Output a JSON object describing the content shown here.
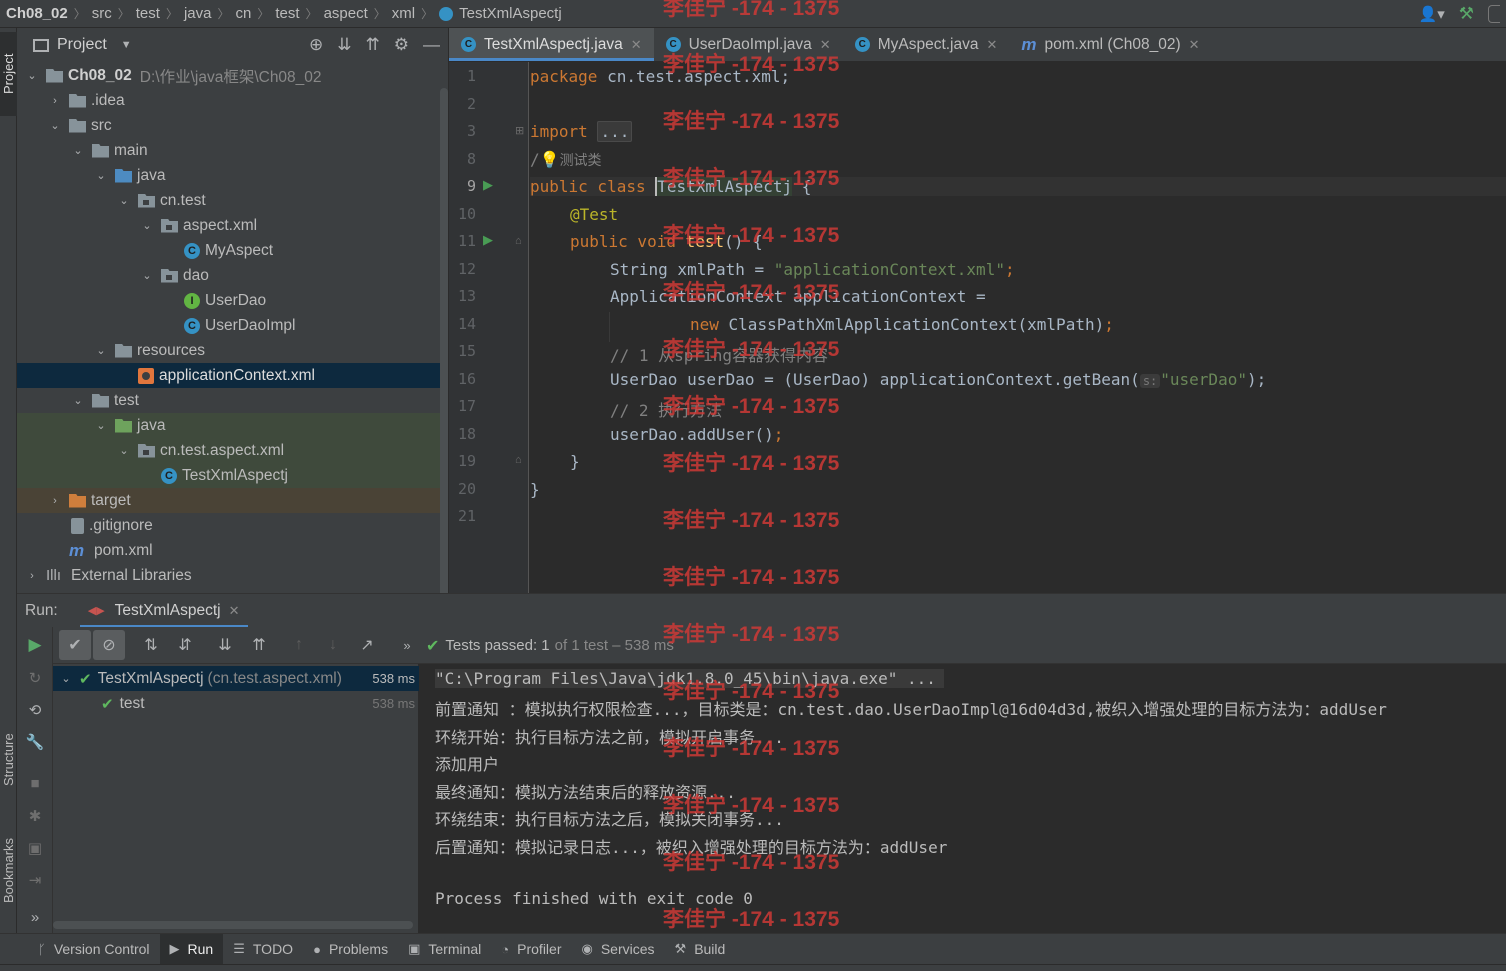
{
  "breadcrumb": {
    "items": [
      "Ch08_02",
      "src",
      "test",
      "java",
      "cn",
      "test",
      "aspect",
      "xml"
    ],
    "file": "TestXmlAspectj"
  },
  "side_labels": {
    "project": "Project",
    "structure": "Structure",
    "bookmarks": "Bookmarks"
  },
  "project_panel": {
    "title": "Project",
    "root": {
      "name": "Ch08_02",
      "path": "D:\\作业\\java框架\\Ch08_02"
    },
    "items": [
      ".idea",
      "src",
      "main",
      "java",
      "cn.test",
      "aspect.xml",
      "MyAspect",
      "dao",
      "UserDao",
      "UserDaoImpl",
      "resources",
      "applicationContext.xml",
      "test",
      "java",
      "cn.test.aspect.xml",
      "TestXmlAspectj",
      "target",
      ".gitignore",
      "pom.xml",
      "External Libraries"
    ]
  },
  "editor_tabs": [
    "TestXmlAspectj.java",
    "UserDaoImpl.java",
    "MyAspect.java",
    "pom.xml (Ch08_02)"
  ],
  "editor": {
    "line_numbers": [
      "1",
      "2",
      "3",
      "8",
      "9",
      "10",
      "11",
      "12",
      "13",
      "14",
      "15",
      "16",
      "17",
      "18",
      "19",
      "20",
      "21"
    ],
    "pkg_kw": "package",
    "pkg_name": "cn.test.aspect.xml;",
    "import_kw": "import",
    "import_fold": "...",
    "doc_prefix": "/",
    "doc_text": "测试类",
    "class_kw": "public class",
    "class_name": "TestXmlAspectj",
    "class_brace": "{",
    "ann": "@Test",
    "method_kw": "public void",
    "method_name": "test",
    "method_rest": "() {",
    "l12_type": "String xmlPath = ",
    "l12_str": "\"applicationContext.xml\"",
    "l12_end": ";",
    "l13": "ApplicationContext applicationContext =",
    "l14_kw": "new",
    "l14_rest": " ClassPathXmlApplicationContext(xmlPath)",
    "l14_end": ";",
    "l15_cm": "// 1 从spring容器获得内容",
    "l16_pre": "UserDao userDao = (UserDao) applicationContext.getBean(",
    "l16_hint": "s:",
    "l16_str": "\"userDao\"",
    "l16_end": ");",
    "l17_cm": "// 2 执行方法",
    "l18": "userDao.addUser()",
    "l18_end": ";",
    "l19": "}",
    "l20": "}"
  },
  "run_panel": {
    "label": "Run:",
    "tab": "TestXmlAspectj",
    "status": {
      "prefix": "Tests passed:",
      "count": "1",
      "suffix": "of 1 test – 538 ms"
    },
    "tree": [
      {
        "name": "TestXmlAspectj",
        "detail": "(cn.test.aspect.xml)",
        "time": "538 ms"
      },
      {
        "name": "test",
        "detail": "",
        "time": "538 ms"
      }
    ],
    "console": [
      "\"C:\\Program Files\\Java\\jdk1.8.0_45\\bin\\java.exe\" ...",
      "前置通知 ：模拟执行权限检查...，目标类是：cn.test.dao.UserDaoImpl@16d04d3d,被织入增强处理的目标方法为：addUser",
      "环绕开始：执行目标方法之前，模拟开启事务...",
      "添加用户",
      "最终通知：模拟方法结束后的释放资源...",
      "环绕结束：执行目标方法之后，模拟关闭事务...",
      "后置通知：模拟记录日志...，被织入增强处理的目标方法为：addUser",
      "",
      "Process finished with exit code 0"
    ]
  },
  "bottom_tools": [
    "Version Control",
    "Run",
    "TODO",
    "Problems",
    "Terminal",
    "Profiler",
    "Services",
    "Build"
  ],
  "watermark": "李佳宁 -174 - 1375",
  "colors": {
    "accent": "#4a88c7",
    "passed": "#5fb85f",
    "watermark": "#d43a37",
    "keyword": "#cc7832",
    "string": "#6a8759"
  }
}
